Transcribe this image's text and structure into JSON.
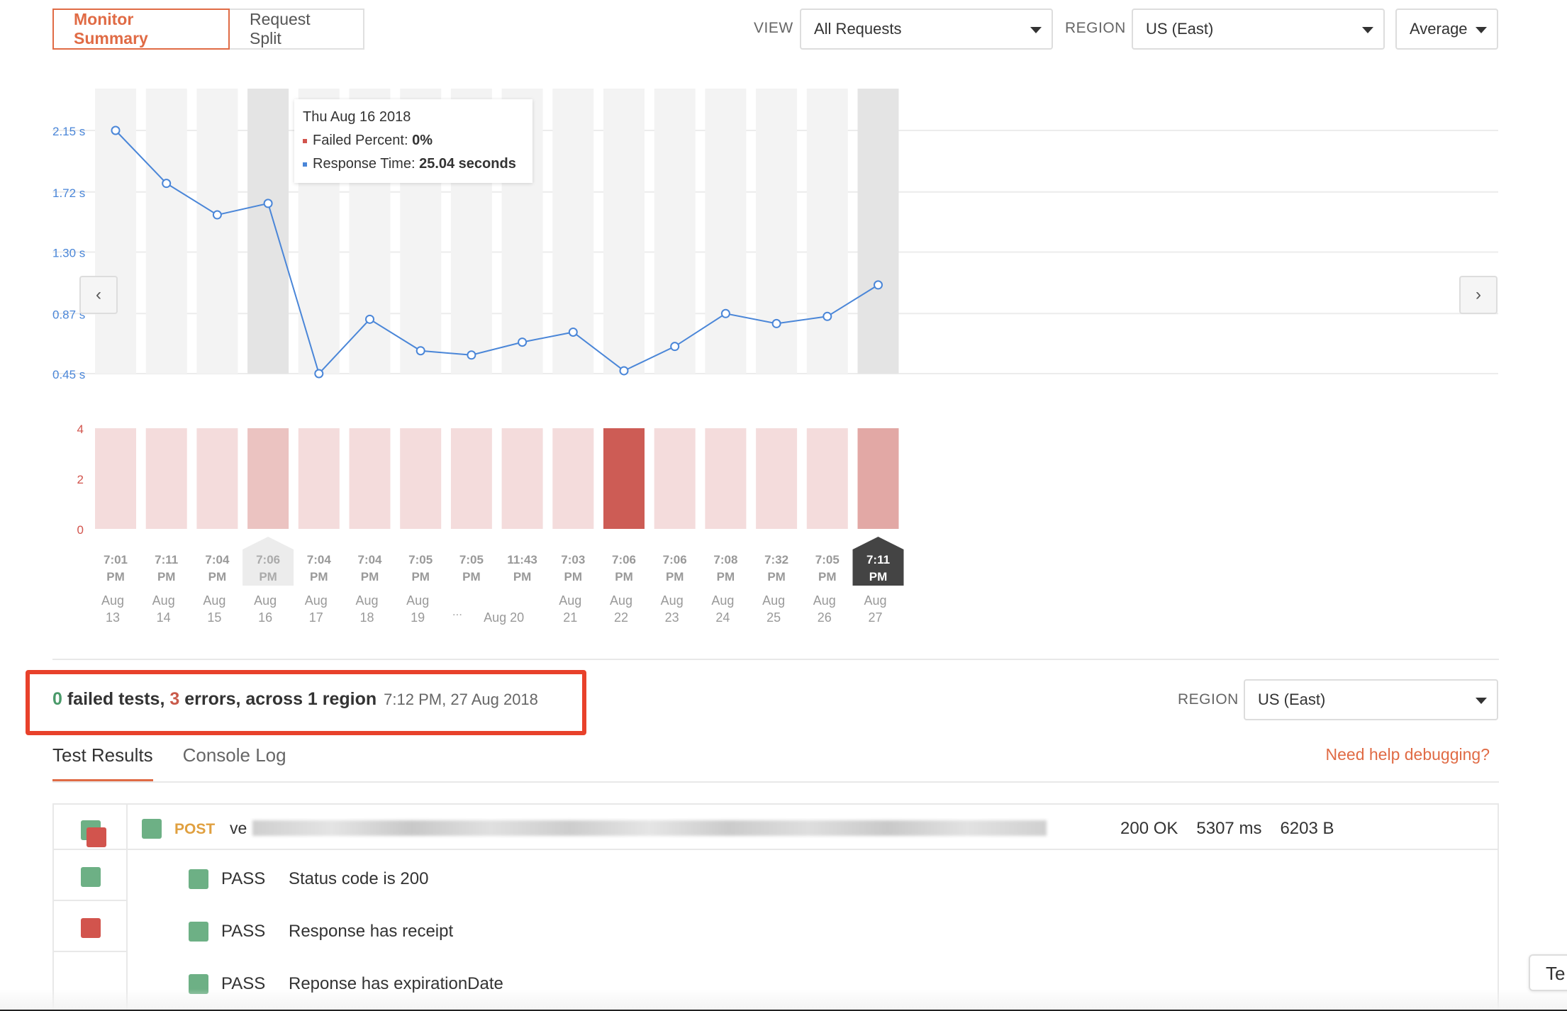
{
  "top_tabs": {
    "monitor_summary": "Monitor Summary",
    "request_split": "Request Split"
  },
  "controls": {
    "view_label": "VIEW",
    "view_value": "All Requests",
    "region_label": "REGION",
    "region_value": "US (East)",
    "aggregate_value": "Average"
  },
  "nav": {
    "prev": "‹",
    "next": "›"
  },
  "tooltip": {
    "date": "Thu Aug 16 2018",
    "failed_label": "Failed Percent:",
    "failed_value": "0%",
    "response_label": "Response Time:",
    "response_value": "25.04 seconds"
  },
  "chart_data": {
    "type": "line",
    "line_series": {
      "y_ticks": [
        "2.15 s",
        "1.72 s",
        "1.30 s",
        "0.87 s",
        "0.45 s"
      ],
      "y_tick_values": [
        2.15,
        1.72,
        1.3,
        0.87,
        0.45
      ],
      "values": [
        2.15,
        1.78,
        1.56,
        1.64,
        0.45,
        0.83,
        0.61,
        0.58,
        0.67,
        0.74,
        0.47,
        0.64,
        0.87,
        0.8,
        0.85,
        1.07
      ],
      "color": "#4a86d8"
    },
    "bar_series": {
      "y_ticks": [
        "4",
        "2",
        "0"
      ],
      "y_tick_values": [
        4,
        2,
        0
      ],
      "values": [
        4,
        4,
        4,
        4,
        4,
        4,
        4,
        4,
        4,
        4,
        4,
        4,
        4,
        4,
        4,
        4
      ],
      "colors": [
        "#f4dcdc",
        "#f4dcdc",
        "#f4dcdc",
        "#ebc3c1",
        "#f4dcdc",
        "#f4dcdc",
        "#f4dcdc",
        "#f4dcdc",
        "#f4dcdc",
        "#f4dcdc",
        "#cd5c55",
        "#f4dcdc",
        "#f4dcdc",
        "#f4dcdc",
        "#f4dcdc",
        "#e2a8a5"
      ]
    },
    "times": [
      "7:01 PM",
      "7:11 PM",
      "7:04 PM",
      "7:06 PM",
      "7:04 PM",
      "7:04 PM",
      "7:05 PM",
      "7:05 PM",
      "11:43 PM",
      "7:03 PM",
      "7:06 PM",
      "7:06 PM",
      "7:08 PM",
      "7:32 PM",
      "7:05 PM",
      "7:11 PM"
    ],
    "dates": [
      "Aug 13",
      "Aug 14",
      "Aug 15",
      "Aug 16",
      "Aug 17",
      "Aug 18",
      "Aug 19",
      "",
      "Aug 20",
      "Aug 21",
      "Aug 22",
      "Aug 23",
      "Aug 24",
      "Aug 25",
      "Aug 26",
      "Aug 27"
    ],
    "ellipsis": "...",
    "hovered_index": 3,
    "selected_index": 15,
    "grid": true
  },
  "summary": {
    "failed_count": "0",
    "failed_text": " failed tests, ",
    "errors_count": "3",
    "errors_text": " errors, across 1 region",
    "timestamp": "7:12 PM, 27 Aug 2018",
    "region_label": "REGION",
    "region_value": "US (East)"
  },
  "result_tabs": {
    "test_results": "Test Results",
    "console_log": "Console Log",
    "help": "Need help debugging?"
  },
  "request": {
    "method": "POST",
    "url_prefix": "ve",
    "status": "200 OK",
    "time": "5307 ms",
    "size": "6203 B"
  },
  "tests": [
    {
      "status": "PASS",
      "name": "Status code is 200"
    },
    {
      "status": "PASS",
      "name": "Response has receipt"
    },
    {
      "status": "PASS",
      "name": "Reponse has expirationDate"
    }
  ],
  "side_tab": "Te",
  "colors": {
    "accent": "#e06b45",
    "pass": "#6db085",
    "fail": "#d2544d",
    "line": "#4a86d8"
  }
}
